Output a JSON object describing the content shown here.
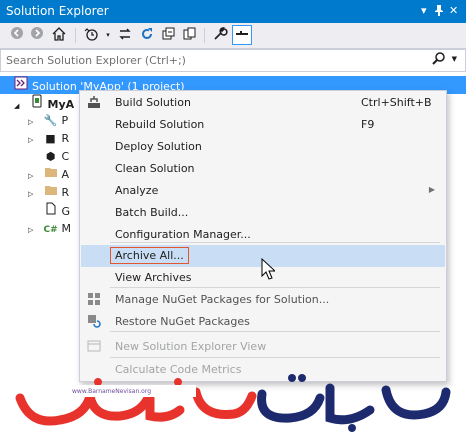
{
  "window": {
    "title": "Solution Explorer",
    "controls": [
      "▾",
      "⊕",
      "✕"
    ]
  },
  "toolbar": {
    "buttons": [
      "back-icon",
      "forward-icon",
      "home-icon",
      "history-icon",
      "sync-icon",
      "refresh-icon",
      "collapse-all-icon",
      "show-all-files-icon",
      "properties-icon",
      "preview-icon"
    ]
  },
  "search": {
    "placeholder": "Search Solution Explorer (Ctrl+;)"
  },
  "tree": {
    "solution_label": "Solution 'MyApp' (1 project)",
    "project_label": "MyA",
    "items": [
      {
        "icon": "properties-wrench-icon",
        "label": "P"
      },
      {
        "icon": "references-icon",
        "label": "R"
      },
      {
        "icon": "package-icon",
        "label": "C"
      },
      {
        "icon": "folder-icon",
        "label": "A"
      },
      {
        "icon": "folder-icon",
        "label": "R"
      },
      {
        "icon": "file-icon",
        "label": "G"
      },
      {
        "icon": "csharp-file-icon",
        "label": "M"
      }
    ]
  },
  "context_menu": {
    "items": [
      {
        "label": "Build Solution",
        "shortcut": "Ctrl+Shift+B",
        "icon": "build-icon",
        "disabled": false
      },
      {
        "label": "Rebuild Solution",
        "shortcut": "F9",
        "icon": "",
        "disabled": false
      },
      {
        "label": "Deploy Solution",
        "shortcut": "",
        "icon": "",
        "disabled": false
      },
      {
        "label": "Clean Solution",
        "shortcut": "",
        "icon": "",
        "disabled": false
      },
      {
        "label": "Analyze",
        "shortcut": "",
        "icon": "",
        "submenu": true,
        "disabled": false
      },
      {
        "label": "Batch Build...",
        "shortcut": "",
        "icon": "",
        "disabled": false
      },
      {
        "label": "Configuration Manager...",
        "shortcut": "",
        "icon": "",
        "disabled": false
      },
      {
        "label": "Archive All...",
        "shortcut": "",
        "icon": "",
        "disabled": false,
        "highlighted": true
      },
      {
        "label": "View Archives",
        "shortcut": "",
        "icon": "",
        "disabled": false
      },
      {
        "label": "Manage NuGet Packages for Solution...",
        "shortcut": "",
        "icon": "nuget-icon",
        "disabled": false
      },
      {
        "label": "Restore NuGet Packages",
        "shortcut": "",
        "icon": "restore-icon",
        "disabled": false
      },
      {
        "label": "New Solution Explorer View",
        "shortcut": "",
        "icon": "new-view-icon",
        "disabled": true
      },
      {
        "label": "Calculate Code Metrics",
        "shortcut": "",
        "icon": "",
        "disabled": true
      }
    ]
  },
  "watermark": {
    "domain": "www.BarnameNevisan.org"
  },
  "colors": {
    "accent": "#007acc",
    "selection": "#3399ff",
    "menu_highlight": "#c9def5",
    "highlight_border": "#e3572f",
    "logo_red": "#e8322c",
    "logo_navy": "#1d2b6e"
  }
}
